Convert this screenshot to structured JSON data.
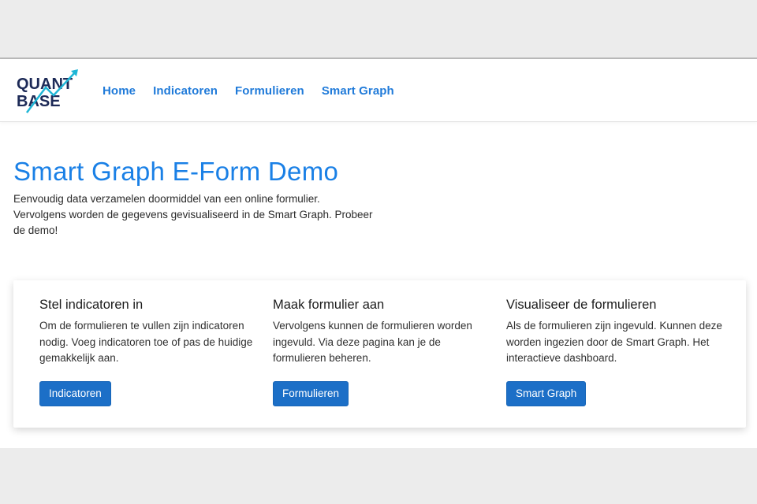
{
  "logo": {
    "line1": "QUANT",
    "line2": "BASE"
  },
  "nav": {
    "items": [
      {
        "label": "Home"
      },
      {
        "label": "Indicatoren"
      },
      {
        "label": "Formulieren"
      },
      {
        "label": "Smart Graph"
      }
    ]
  },
  "hero": {
    "title": "Smart Graph E-Form Demo",
    "description_lines": [
      "Eenvoudig data verzamelen doormiddel van een online formulier.",
      "Vervolgens worden de gegevens gevisualiseerd in de Smart Graph. Probeer",
      "de demo!"
    ]
  },
  "features": [
    {
      "title": "Stel indicatoren in",
      "text_lines": [
        "Om de formulieren te vullen zijn indicatoren",
        "nodig. Voeg indicatoren toe of pas de huidige",
        "gemakkelijk aan."
      ],
      "button": "Indicatoren"
    },
    {
      "title": "Maak formulier aan",
      "text_lines": [
        "Vervolgens kunnen de formulieren worden",
        "ingevuld. Via deze pagina kan je de",
        "formulieren beheren."
      ],
      "button": "Formulieren"
    },
    {
      "title": "Visualiseer de formulieren",
      "text_lines": [
        "Als de formulieren zijn ingevuld. Kunnen deze",
        "worden ingezien door de Smart Graph. Het",
        "interactieve dashboard."
      ],
      "button": "Smart Graph"
    }
  ],
  "colors": {
    "accent": "#1a80e6",
    "button": "#1c6fc7",
    "logo_text": "#1d2a57",
    "logo_arrow": "#1fb6d6"
  }
}
